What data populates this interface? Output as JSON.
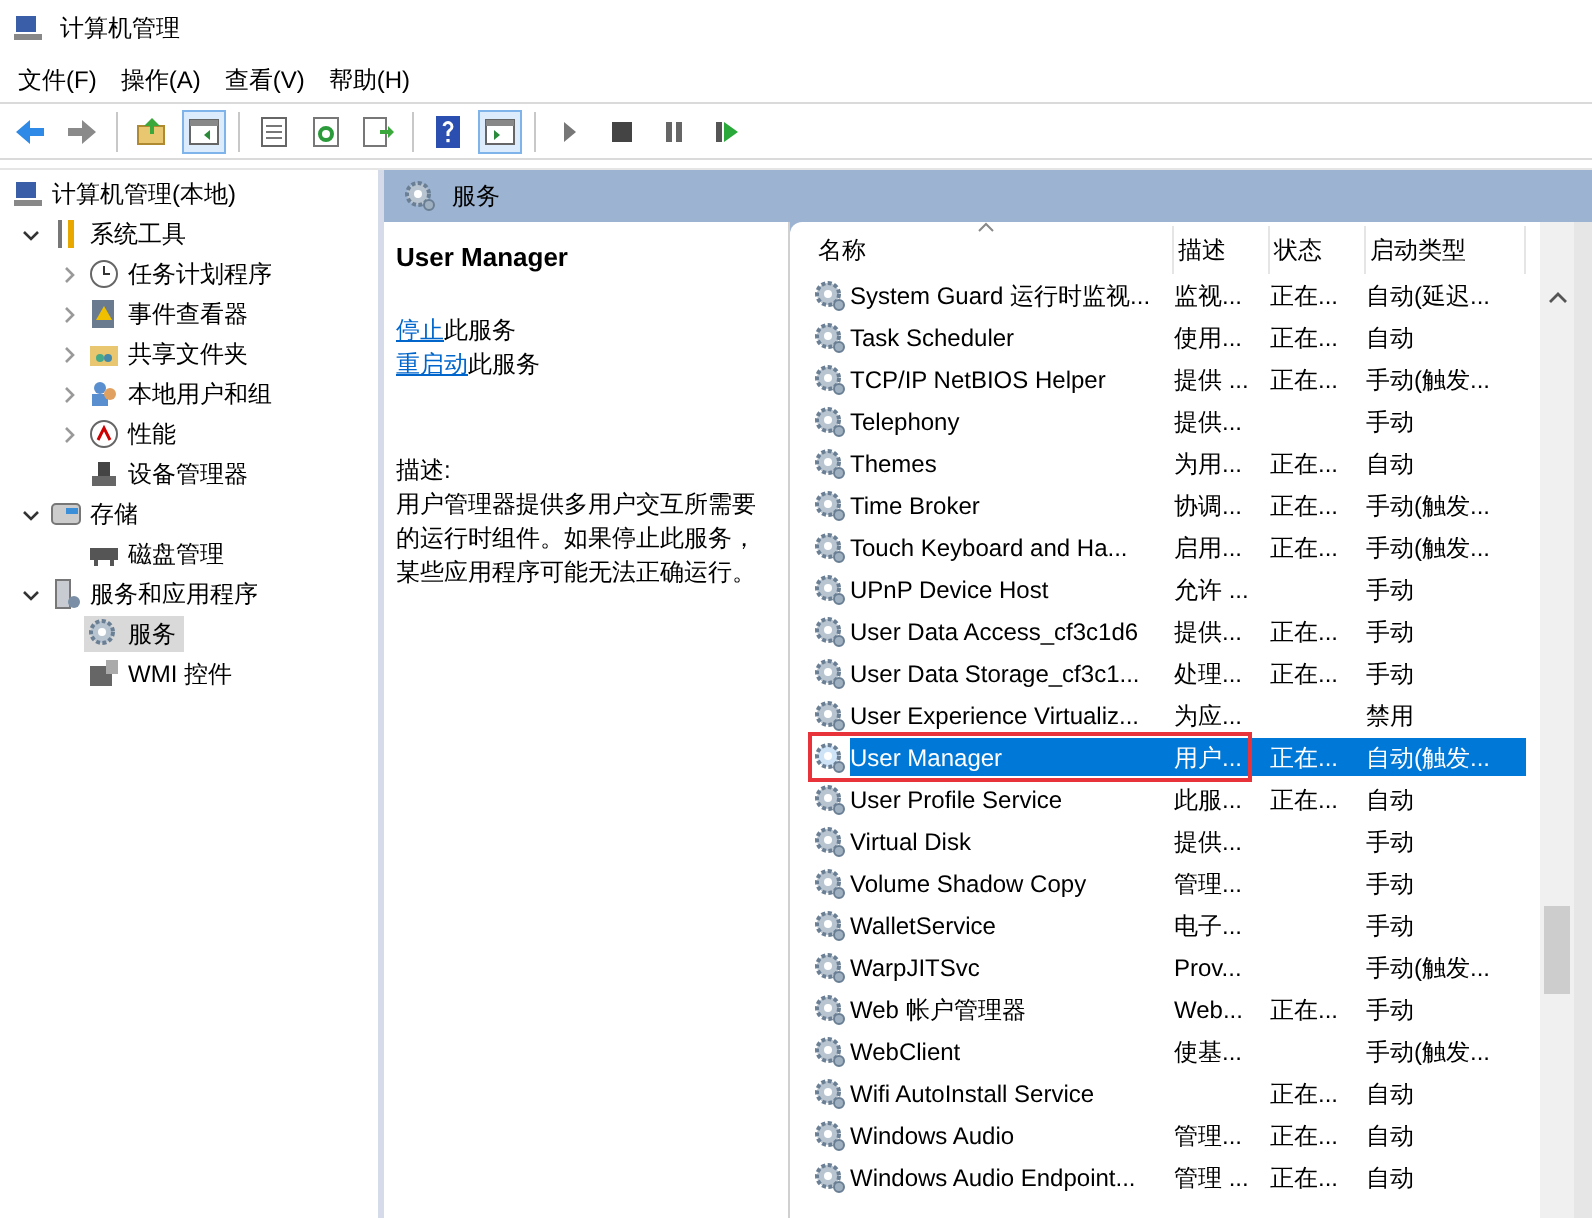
{
  "window": {
    "title": "计算机管理"
  },
  "menu": [
    "文件(F)",
    "操作(A)",
    "查看(V)",
    "帮助(H)"
  ],
  "toolbar": [
    {
      "kind": "back"
    },
    {
      "kind": "forward"
    },
    {
      "kind": "sep"
    },
    {
      "kind": "up"
    },
    {
      "kind": "pane",
      "selected": true
    },
    {
      "kind": "sep"
    },
    {
      "kind": "props"
    },
    {
      "kind": "refresh"
    },
    {
      "kind": "export"
    },
    {
      "kind": "sep"
    },
    {
      "kind": "help"
    },
    {
      "kind": "pane2",
      "selected": true
    },
    {
      "kind": "sep"
    },
    {
      "kind": "play"
    },
    {
      "kind": "stop"
    },
    {
      "kind": "pause"
    },
    {
      "kind": "resume"
    }
  ],
  "tree": [
    {
      "label": "计算机管理(本地)",
      "kind": "computer",
      "selected": false,
      "children": [
        {
          "label": "系统工具",
          "kind": "tools",
          "expanded": true,
          "selected": false,
          "children": [
            {
              "label": "任务计划程序",
              "kind": "clock",
              "expanded": false,
              "selected": false
            },
            {
              "label": "事件查看器",
              "kind": "event",
              "expanded": false,
              "selected": false
            },
            {
              "label": "共享文件夹",
              "kind": "share",
              "expanded": false,
              "selected": false
            },
            {
              "label": "本地用户和组",
              "kind": "users",
              "expanded": false,
              "selected": false
            },
            {
              "label": "性能",
              "kind": "perf",
              "expanded": false,
              "selected": false
            },
            {
              "label": "设备管理器",
              "kind": "device",
              "selected": false
            }
          ]
        },
        {
          "label": "存储",
          "kind": "storage",
          "expanded": true,
          "selected": false,
          "children": [
            {
              "label": "磁盘管理",
              "kind": "disk",
              "selected": false
            }
          ]
        },
        {
          "label": "服务和应用程序",
          "kind": "apps",
          "expanded": true,
          "selected": false,
          "children": [
            {
              "label": "服务",
              "kind": "gear",
              "selected": true
            },
            {
              "label": "WMI 控件",
              "kind": "wmi",
              "selected": false
            }
          ]
        }
      ]
    }
  ],
  "panel_title": "服务",
  "details": {
    "service_name": "User Manager",
    "actions": [
      {
        "link": "停止",
        "rest": "此服务"
      },
      {
        "link": "重启动",
        "rest": "此服务"
      }
    ],
    "description_label": "描述:",
    "description": "用户管理器提供多用户交互所需要的运行时组件。如果停止此服务，某些应用程序可能无法正确运行。"
  },
  "table": {
    "columns": [
      {
        "label": "名称",
        "sorted": true
      },
      {
        "label": "描述",
        "sorted": false
      },
      {
        "label": "状态",
        "sorted": false
      },
      {
        "label": "启动类型",
        "sorted": false
      }
    ],
    "rows": [
      {
        "name": "System Guard 运行时监视...",
        "description": "监视...",
        "status": "正在...",
        "startup": "自动(延迟...",
        "selected": false,
        "annotated": false
      },
      {
        "name": "Task Scheduler",
        "description": "使用...",
        "status": "正在...",
        "startup": "自动",
        "selected": false,
        "annotated": false
      },
      {
        "name": "TCP/IP NetBIOS Helper",
        "description": "提供 ...",
        "status": "正在...",
        "startup": "手动(触发...",
        "selected": false,
        "annotated": false
      },
      {
        "name": "Telephony",
        "description": "提供...",
        "status": "",
        "startup": "手动",
        "selected": false,
        "annotated": false
      },
      {
        "name": "Themes",
        "description": "为用...",
        "status": "正在...",
        "startup": "自动",
        "selected": false,
        "annotated": false
      },
      {
        "name": "Time Broker",
        "description": "协调...",
        "status": "正在...",
        "startup": "手动(触发...",
        "selected": false,
        "annotated": false
      },
      {
        "name": "Touch Keyboard and Ha...",
        "description": "启用...",
        "status": "正在...",
        "startup": "手动(触发...",
        "selected": false,
        "annotated": false
      },
      {
        "name": "UPnP Device Host",
        "description": "允许 ...",
        "status": "",
        "startup": "手动",
        "selected": false,
        "annotated": false
      },
      {
        "name": "User Data Access_cf3c1d6",
        "description": "提供...",
        "status": "正在...",
        "startup": "手动",
        "selected": false,
        "annotated": false
      },
      {
        "name": "User Data Storage_cf3c1...",
        "description": "处理...",
        "status": "正在...",
        "startup": "手动",
        "selected": false,
        "annotated": false
      },
      {
        "name": "User Experience Virtualiz...",
        "description": "为应...",
        "status": "",
        "startup": "禁用",
        "selected": false,
        "annotated": false
      },
      {
        "name": "User Manager",
        "description": "用户...",
        "status": "正在...",
        "startup": "自动(触发...",
        "selected": true,
        "annotated": true
      },
      {
        "name": "User Profile Service",
        "description": "此服...",
        "status": "正在...",
        "startup": "自动",
        "selected": false,
        "annotated": false
      },
      {
        "name": "Virtual Disk",
        "description": "提供...",
        "status": "",
        "startup": "手动",
        "selected": false,
        "annotated": false
      },
      {
        "name": "Volume Shadow Copy",
        "description": "管理...",
        "status": "",
        "startup": "手动",
        "selected": false,
        "annotated": false
      },
      {
        "name": "WalletService",
        "description": "电子...",
        "status": "",
        "startup": "手动",
        "selected": false,
        "annotated": false
      },
      {
        "name": "WarpJITSvc",
        "description": "Prov...",
        "status": "",
        "startup": "手动(触发...",
        "selected": false,
        "annotated": false
      },
      {
        "name": "Web 帐户管理器",
        "description": "Web...",
        "status": "正在...",
        "startup": "手动",
        "selected": false,
        "annotated": false
      },
      {
        "name": "WebClient",
        "description": "使基...",
        "status": "",
        "startup": "手动(触发...",
        "selected": false,
        "annotated": false
      },
      {
        "name": "Wifi AutoInstall Service",
        "description": "",
        "status": "正在...",
        "startup": "自动",
        "selected": false,
        "annotated": false
      },
      {
        "name": "Windows Audio",
        "description": "管理...",
        "status": "正在...",
        "startup": "自动",
        "selected": false,
        "annotated": false
      },
      {
        "name": "Windows Audio Endpoint...",
        "description": "管理 ...",
        "status": "正在...",
        "startup": "自动",
        "selected": false,
        "annotated": false
      }
    ]
  }
}
